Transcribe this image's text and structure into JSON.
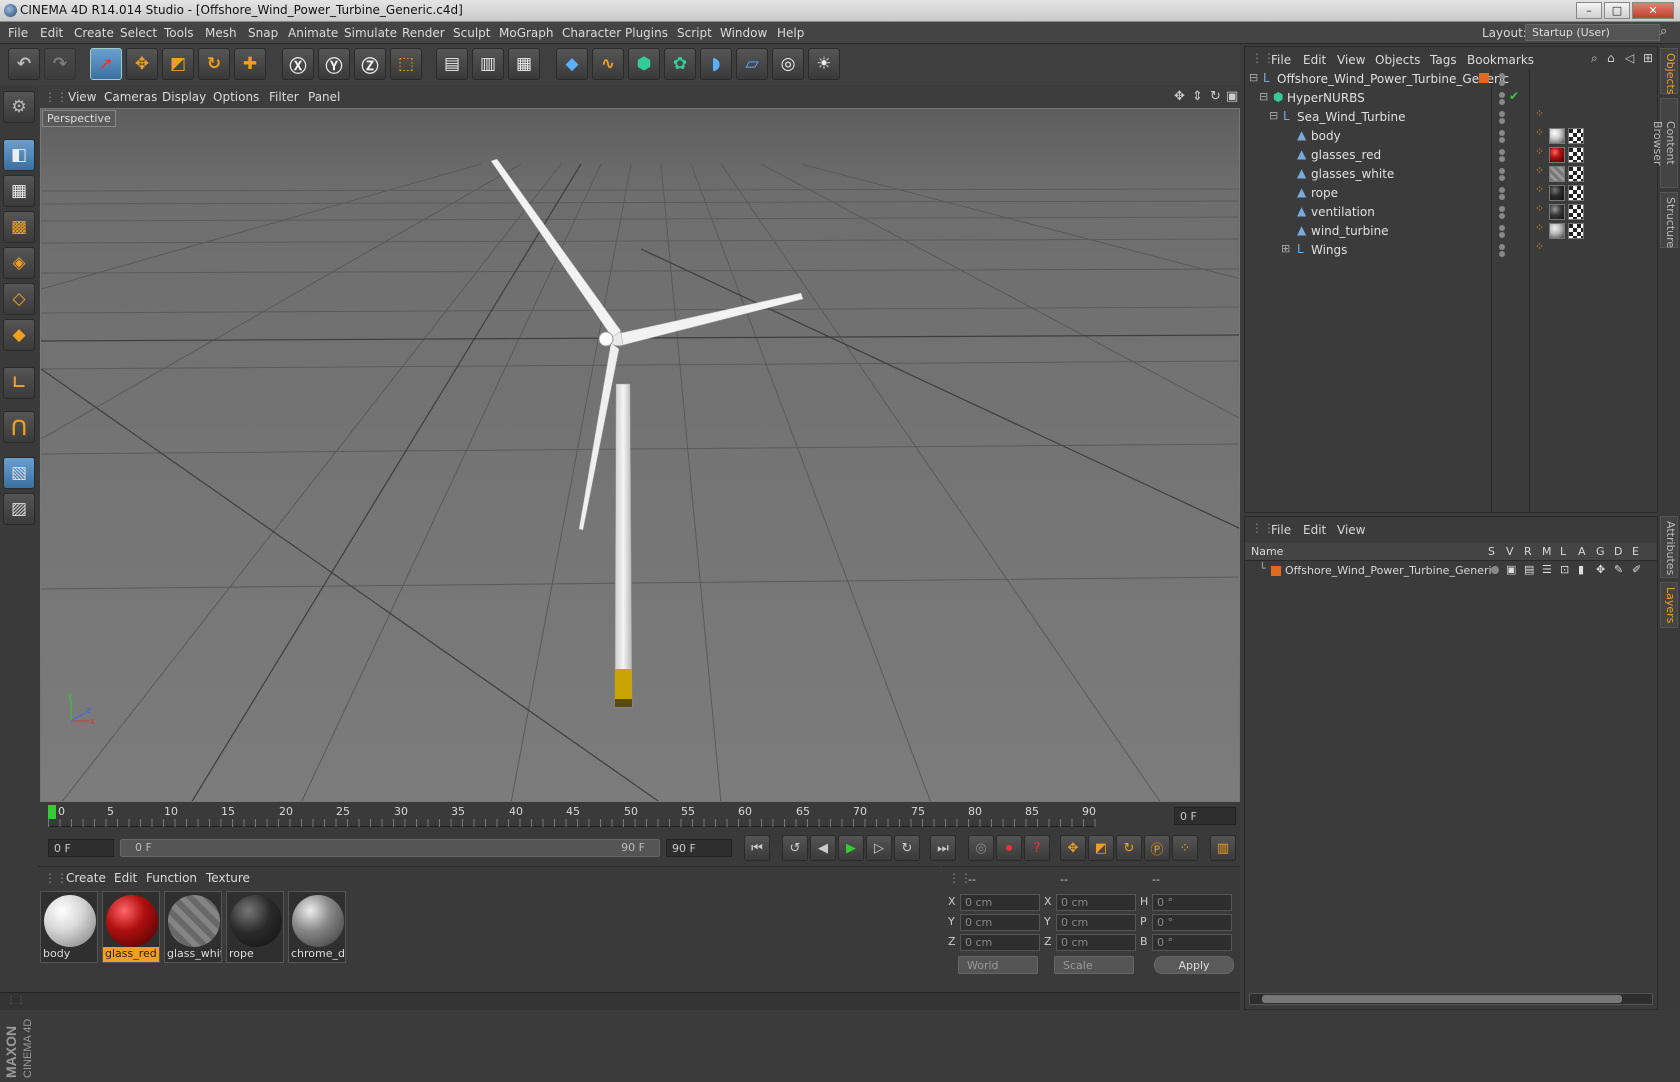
{
  "window": {
    "title": "CINEMA 4D R14.014 Studio - [Offshore_Wind_Power_Turbine_Generic.c4d]",
    "buttons": [
      "–",
      "□",
      "✕"
    ]
  },
  "menu": [
    "File",
    "Edit",
    "Create",
    "Select",
    "Tools",
    "Mesh",
    "Snap",
    "Animate",
    "Simulate",
    "Render",
    "Sculpt",
    "MoGraph",
    "Character",
    "Plugins",
    "Script",
    "Window",
    "Help"
  ],
  "layout": {
    "label": "Layout:",
    "value": "Startup (User)"
  },
  "viewport": {
    "menu": [
      "View",
      "Cameras",
      "Display",
      "Options",
      "Filter",
      "Panel"
    ],
    "label": "Perspective"
  },
  "timeline": {
    "ticks": [
      "0",
      "5",
      "10",
      "15",
      "20",
      "25",
      "30",
      "35",
      "40",
      "45",
      "50",
      "55",
      "60",
      "65",
      "70",
      "75",
      "80",
      "85",
      "90"
    ],
    "current_frame": "0 F",
    "start_field": "0 F",
    "range_start": "0 F",
    "range_end": "90 F",
    "end_field": "90 F"
  },
  "materials": {
    "menu": [
      "Create",
      "Edit",
      "Function",
      "Texture"
    ],
    "items": [
      {
        "name": "body",
        "color": "#e0e0e0"
      },
      {
        "name": "glass_red",
        "color": "#b01010"
      },
      {
        "name": "glass_whit",
        "color": "#9a9a9a"
      },
      {
        "name": "rope",
        "color": "#2a2a2a"
      },
      {
        "name": "chrome_de",
        "color": "#8a8a8a"
      }
    ]
  },
  "coords": {
    "headers": [
      "--",
      "--",
      "--"
    ],
    "rows": [
      {
        "a": "X",
        "av": "0 cm",
        "b": "X",
        "bv": "0 cm",
        "c": "H",
        "cv": "0 °"
      },
      {
        "a": "Y",
        "av": "0 cm",
        "b": "Y",
        "bv": "0 cm",
        "c": "P",
        "cv": "0 °"
      },
      {
        "a": "Z",
        "av": "0 cm",
        "b": "Z",
        "bv": "0 cm",
        "c": "B",
        "cv": "0 °"
      }
    ],
    "world": "World",
    "scale": "Scale",
    "apply": "Apply"
  },
  "objects": {
    "menu": [
      "File",
      "Edit",
      "View",
      "Objects",
      "Tags",
      "Bookmarks"
    ],
    "tree": [
      {
        "name": "Offshore_Wind_Power_Turbine_Generic",
        "level": 0,
        "icon": "null-icon"
      },
      {
        "name": "HyperNURBS",
        "level": 1,
        "icon": "hypernurbs-icon"
      },
      {
        "name": "Sea_Wind_Turbine",
        "level": 2,
        "icon": "null-icon"
      },
      {
        "name": "body",
        "level": 3,
        "icon": "polygon-icon",
        "tag": "#cfcfcf"
      },
      {
        "name": "glasses_red",
        "level": 3,
        "icon": "polygon-icon",
        "tag": "#b01010"
      },
      {
        "name": "glasses_white",
        "level": 3,
        "icon": "polygon-icon",
        "tag": "#888888"
      },
      {
        "name": "rope",
        "level": 3,
        "icon": "polygon-icon",
        "tag": "#2a2a2a"
      },
      {
        "name": "ventilation",
        "level": 3,
        "icon": "polygon-icon",
        "tag": "#3a3a3a"
      },
      {
        "name": "wind_turbine",
        "level": 3,
        "icon": "polygon-icon",
        "tag": "#bdbdbd"
      },
      {
        "name": "Wings",
        "level": 3,
        "icon": "null-icon"
      }
    ]
  },
  "layers": {
    "menu": [
      "File",
      "Edit",
      "View"
    ],
    "columns": {
      "name": "Name",
      "flags": [
        "S",
        "V",
        "R",
        "M",
        "L",
        "A",
        "G",
        "D",
        "E"
      ]
    },
    "rows": [
      {
        "name": "Offshore_Wind_Power_Turbine_Generic",
        "color": "#e06a20"
      }
    ]
  },
  "side_tabs": [
    "Objects",
    "Content Browser",
    "Structure",
    "Attributes",
    "Layers"
  ],
  "brand": {
    "line1": "MAXON",
    "line2": "CINEMA 4D"
  }
}
